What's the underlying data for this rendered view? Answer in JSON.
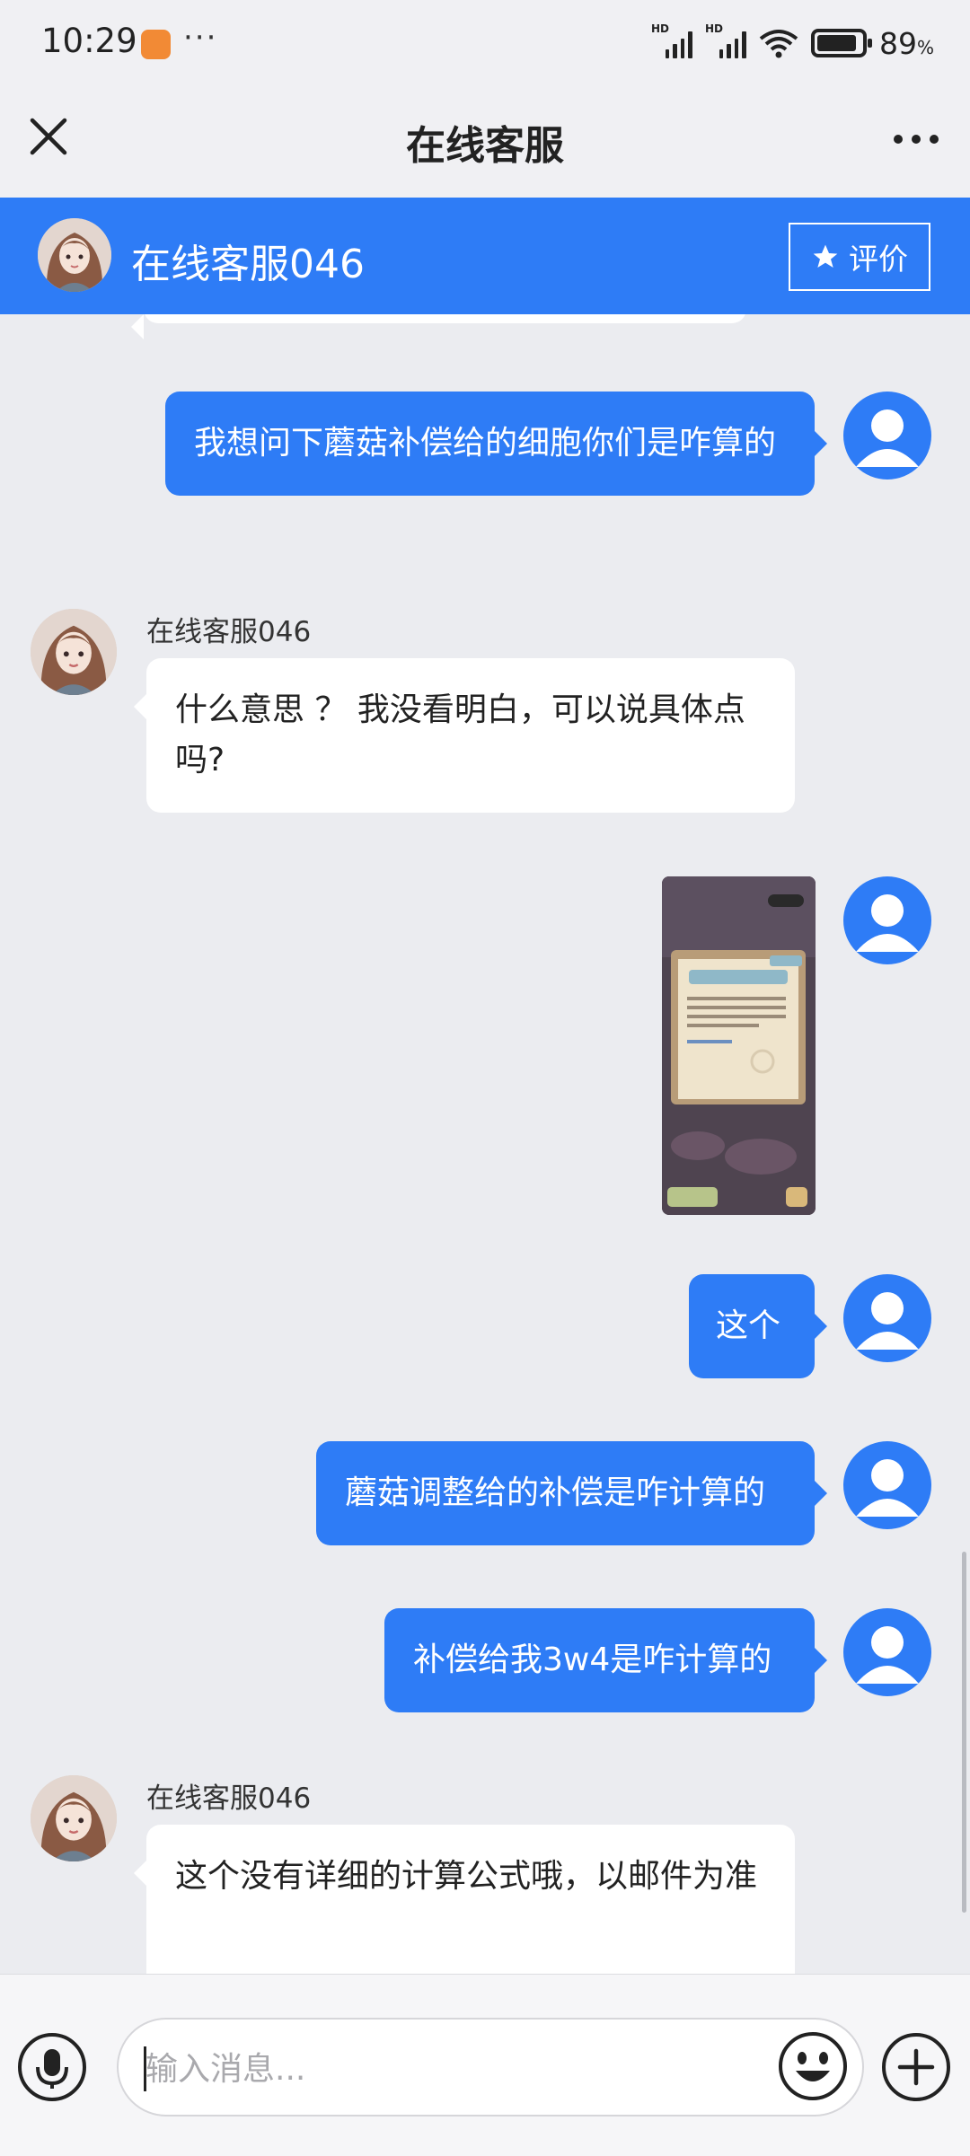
{
  "status_bar": {
    "time": "10:29",
    "more": "···",
    "signal1_label": "HD",
    "signal2_label": "HD",
    "battery_percent": "89",
    "battery_unit": "%",
    "battery_level": 0.89
  },
  "nav": {
    "title": "在线客服",
    "close_icon": "close-icon",
    "more_icon": "more-icon"
  },
  "agent_bar": {
    "name": "在线客服046",
    "rate_label": "评价",
    "rate_icon": "star-icon"
  },
  "messages": [
    {
      "side": "out",
      "text": "我想问下蘑菇补偿给的细胞你们是咋算的"
    },
    {
      "side": "in",
      "sender": "在线客服046",
      "text": "什么意思 ？ 我没看明白，可以说具体点吗?"
    },
    {
      "side": "out",
      "type": "image"
    },
    {
      "side": "out",
      "text": "这个"
    },
    {
      "side": "out",
      "text": "蘑菇调整给的补偿是咋计算的"
    },
    {
      "side": "out",
      "text": "补偿给我3w4是咋计算的"
    },
    {
      "side": "in",
      "sender": "在线客服046",
      "text": "这个没有详细的计算公式哦，以邮件为准"
    }
  ],
  "composer": {
    "placeholder": "输入消息...",
    "value": ""
  },
  "colors": {
    "accent": "#2e7cf6",
    "background": "#ebecf0",
    "bar": "#f0f0f3"
  }
}
